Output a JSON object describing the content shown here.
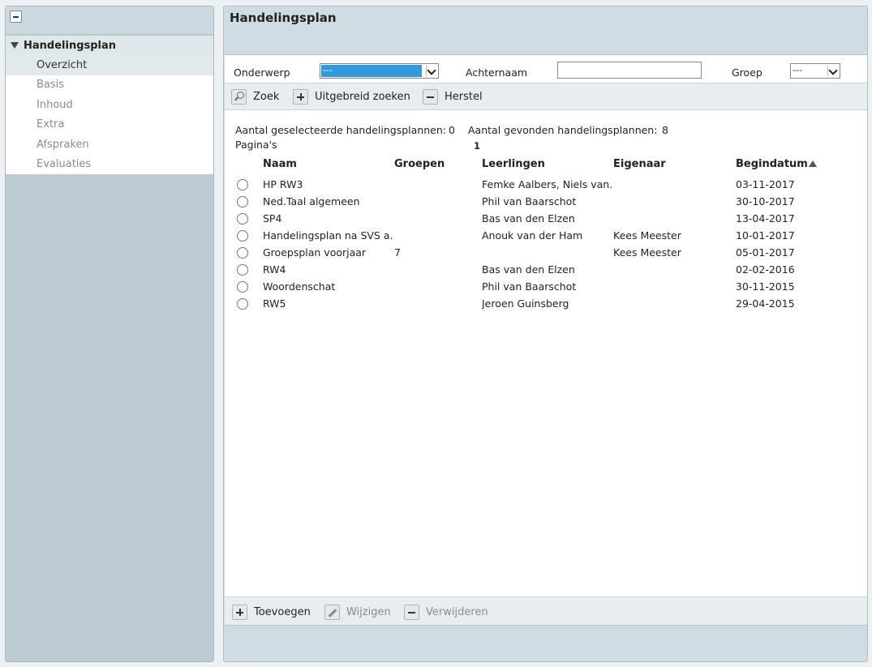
{
  "sidebar": {
    "header": "Handelingsplan",
    "items": [
      {
        "label": "Overzicht"
      },
      {
        "label": "Basis"
      },
      {
        "label": "Inhoud"
      },
      {
        "label": "Extra"
      },
      {
        "label": "Afspraken"
      },
      {
        "label": "Evaluaties"
      }
    ]
  },
  "main": {
    "title": "Handelingsplan",
    "filters": {
      "onderwerp_label": "Onderwerp",
      "onderwerp_value": "---",
      "achternaam_label": "Achternaam",
      "achternaam_value": "",
      "groep_label": "Groep",
      "groep_value": "---"
    },
    "toolbar": {
      "zoek": "Zoek",
      "uitgebreid": "Uitgebreid zoeken",
      "herstel": "Herstel"
    },
    "stats": {
      "selected_label": "Aantal geselecteerde handelingsplannen:",
      "selected_value": "0",
      "found_label": "Aantal gevonden handelingsplannen:",
      "found_value": "8",
      "pages_label": "Pagina's",
      "pages_value": "1"
    },
    "table": {
      "columns": [
        "Naam",
        "Groepen",
        "Leerlingen",
        "Eigenaar",
        "Begindatum"
      ],
      "rows": [
        {
          "naam": "HP RW3",
          "groepen": "",
          "leerlingen": "Femke Aalbers, Niels van…",
          "eigenaar": "",
          "begindatum": "03-11-2017"
        },
        {
          "naam": "Ned.Taal algemeen",
          "groepen": "",
          "leerlingen": "Phil van Baarschot",
          "eigenaar": "",
          "begindatum": "30-10-2017"
        },
        {
          "naam": "SP4",
          "groepen": "",
          "leerlingen": "Bas van den Elzen",
          "eigenaar": "",
          "begindatum": "13-04-2017"
        },
        {
          "naam": "Handelingsplan na SVS a…",
          "groepen": "",
          "leerlingen": "Anouk van der Ham",
          "eigenaar": "Kees Meester",
          "begindatum": "10-01-2017"
        },
        {
          "naam": "Groepsplan voorjaar",
          "groepen": "7",
          "leerlingen": "",
          "eigenaar": "Kees Meester",
          "begindatum": "05-01-2017"
        },
        {
          "naam": "RW4",
          "groepen": "",
          "leerlingen": "Bas van den Elzen",
          "eigenaar": "",
          "begindatum": "02-02-2016"
        },
        {
          "naam": "Woordenschat",
          "groepen": "",
          "leerlingen": "Phil van Baarschot",
          "eigenaar": "",
          "begindatum": "30-11-2015"
        },
        {
          "naam": "RW5",
          "groepen": "",
          "leerlingen": "Jeroen Guinsberg",
          "eigenaar": "",
          "begindatum": "29-04-2015"
        }
      ]
    },
    "bottom": {
      "toevoegen": "Toevoegen",
      "wijzigen": "Wijzigen",
      "verwijderen": "Verwijderen"
    }
  },
  "colors": {
    "panel_bg": "#bccbd3",
    "header_bg": "#cfdce3",
    "select_highlight": "#3399dd"
  }
}
